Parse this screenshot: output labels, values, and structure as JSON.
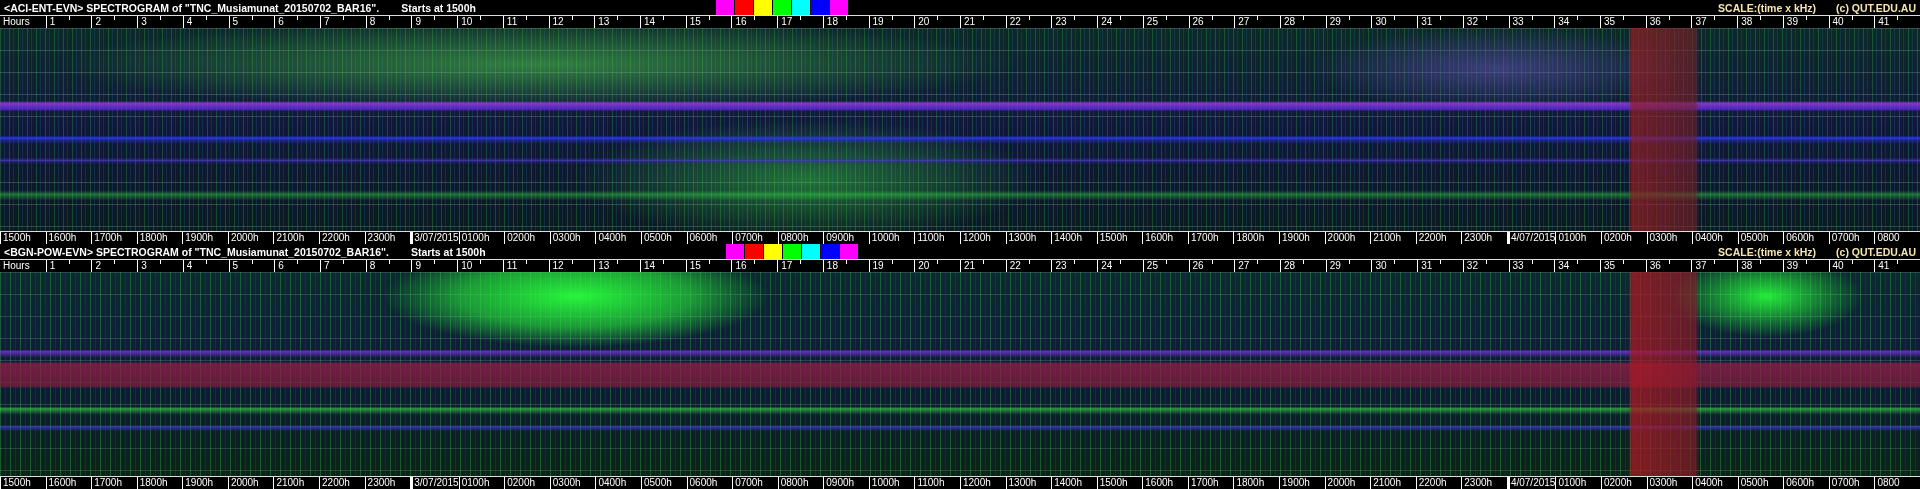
{
  "panels": [
    {
      "title": "<ACI-ENT-EVN> SPECTROGRAM  of \"TNC_Musiamunat_20150702_BAR16\".",
      "start": "Starts at 1500h",
      "swatches": [
        {
          "color": "#ff00ff"
        },
        {
          "color": "#ff0000"
        },
        {
          "color": "#ffff00"
        },
        {
          "color": "#00ff00"
        },
        {
          "color": "#00ffff"
        },
        {
          "color": "#0000ff"
        },
        {
          "color": "#ff00ff"
        }
      ],
      "scale": "SCALE:(time x kHz)",
      "credit": "(c) QUT.EDU.AU",
      "hours_label": "Hours",
      "hour_ticks": [
        "1",
        "2",
        "3",
        "4",
        "5",
        "6",
        "7",
        "8",
        "9",
        "10",
        "11",
        "12",
        "13",
        "14",
        "15",
        "16",
        "17",
        "18",
        "19",
        "20",
        "21",
        "22",
        "23",
        "24",
        "25",
        "26",
        "27",
        "28",
        "29",
        "30",
        "31",
        "32",
        "33",
        "34",
        "35",
        "36",
        "37",
        "38",
        "39",
        "40",
        "41"
      ],
      "time_labels": [
        {
          "text": "1500h",
          "kind": "hour"
        },
        {
          "text": "1600h",
          "kind": "hour"
        },
        {
          "text": "1700h",
          "kind": "hour"
        },
        {
          "text": "1800h",
          "kind": "hour"
        },
        {
          "text": "1900h",
          "kind": "hour"
        },
        {
          "text": "2000h",
          "kind": "hour"
        },
        {
          "text": "2100h",
          "kind": "hour"
        },
        {
          "text": "2200h",
          "kind": "hour"
        },
        {
          "text": "2300h",
          "kind": "hour"
        },
        {
          "text": "3/07/2015",
          "kind": "date"
        },
        {
          "text": "0100h",
          "kind": "hour"
        },
        {
          "text": "0200h",
          "kind": "hour"
        },
        {
          "text": "0300h",
          "kind": "hour"
        },
        {
          "text": "0400h",
          "kind": "hour"
        },
        {
          "text": "0500h",
          "kind": "hour"
        },
        {
          "text": "0600h",
          "kind": "hour"
        },
        {
          "text": "0700h",
          "kind": "hour"
        },
        {
          "text": "0800h",
          "kind": "hour"
        },
        {
          "text": "0900h",
          "kind": "hour"
        },
        {
          "text": "1000h",
          "kind": "hour"
        },
        {
          "text": "1100h",
          "kind": "hour"
        },
        {
          "text": "1200h",
          "kind": "hour"
        },
        {
          "text": "1300h",
          "kind": "hour"
        },
        {
          "text": "1400h",
          "kind": "hour"
        },
        {
          "text": "1500h",
          "kind": "hour"
        },
        {
          "text": "1600h",
          "kind": "hour"
        },
        {
          "text": "1700h",
          "kind": "hour"
        },
        {
          "text": "1800h",
          "kind": "hour"
        },
        {
          "text": "1900h",
          "kind": "hour"
        },
        {
          "text": "2000h",
          "kind": "hour"
        },
        {
          "text": "2100h",
          "kind": "hour"
        },
        {
          "text": "2200h",
          "kind": "hour"
        },
        {
          "text": "2300h",
          "kind": "hour"
        },
        {
          "text": "4/07/2015",
          "kind": "date"
        },
        {
          "text": "0100h",
          "kind": "hour"
        },
        {
          "text": "0200h",
          "kind": "hour"
        },
        {
          "text": "0300h",
          "kind": "hour"
        },
        {
          "text": "0400h",
          "kind": "hour"
        },
        {
          "text": "0500h",
          "kind": "hour"
        },
        {
          "text": "0600h",
          "kind": "hour"
        },
        {
          "text": "0700h",
          "kind": "hour"
        },
        {
          "text": "0800",
          "kind": "hour"
        }
      ]
    },
    {
      "title": "<BGN-POW-EVN> SPECTROGRAM  of \"TNC_Musiamunat_20150702_BAR16\".",
      "start": "Starts at 1500h",
      "swatches": [
        {
          "color": "#ff00ff"
        },
        {
          "color": "#ff0000"
        },
        {
          "color": "#ffff00"
        },
        {
          "color": "#00ff00"
        },
        {
          "color": "#00ffff"
        },
        {
          "color": "#0000ff"
        },
        {
          "color": "#ff00ff"
        }
      ],
      "scale": "SCALE:(time x kHz)",
      "credit": "(c) QUT.EDU.AU",
      "hours_label": "Hours",
      "hour_ticks": [
        "1",
        "2",
        "3",
        "4",
        "5",
        "6",
        "7",
        "8",
        "9",
        "10",
        "11",
        "12",
        "13",
        "14",
        "15",
        "16",
        "17",
        "18",
        "19",
        "20",
        "21",
        "22",
        "23",
        "24",
        "25",
        "26",
        "27",
        "28",
        "29",
        "30",
        "31",
        "32",
        "33",
        "34",
        "35",
        "36",
        "37",
        "38",
        "39",
        "40",
        "41"
      ],
      "time_labels": [
        {
          "text": "1500h",
          "kind": "hour"
        },
        {
          "text": "1600h",
          "kind": "hour"
        },
        {
          "text": "1700h",
          "kind": "hour"
        },
        {
          "text": "1800h",
          "kind": "hour"
        },
        {
          "text": "1900h",
          "kind": "hour"
        },
        {
          "text": "2000h",
          "kind": "hour"
        },
        {
          "text": "2100h",
          "kind": "hour"
        },
        {
          "text": "2200h",
          "kind": "hour"
        },
        {
          "text": "2300h",
          "kind": "hour"
        },
        {
          "text": "3/07/2015",
          "kind": "date"
        },
        {
          "text": "0100h",
          "kind": "hour"
        },
        {
          "text": "0200h",
          "kind": "hour"
        },
        {
          "text": "0300h",
          "kind": "hour"
        },
        {
          "text": "0400h",
          "kind": "hour"
        },
        {
          "text": "0500h",
          "kind": "hour"
        },
        {
          "text": "0600h",
          "kind": "hour"
        },
        {
          "text": "0700h",
          "kind": "hour"
        },
        {
          "text": "0800h",
          "kind": "hour"
        },
        {
          "text": "0900h",
          "kind": "hour"
        },
        {
          "text": "1000h",
          "kind": "hour"
        },
        {
          "text": "1100h",
          "kind": "hour"
        },
        {
          "text": "1200h",
          "kind": "hour"
        },
        {
          "text": "1300h",
          "kind": "hour"
        },
        {
          "text": "1400h",
          "kind": "hour"
        },
        {
          "text": "1500h",
          "kind": "hour"
        },
        {
          "text": "1600h",
          "kind": "hour"
        },
        {
          "text": "1700h",
          "kind": "hour"
        },
        {
          "text": "1800h",
          "kind": "hour"
        },
        {
          "text": "1900h",
          "kind": "hour"
        },
        {
          "text": "2000h",
          "kind": "hour"
        },
        {
          "text": "2100h",
          "kind": "hour"
        },
        {
          "text": "2200h",
          "kind": "hour"
        },
        {
          "text": "2300h",
          "kind": "hour"
        },
        {
          "text": "4/07/2015",
          "kind": "date"
        },
        {
          "text": "0100h",
          "kind": "hour"
        },
        {
          "text": "0200h",
          "kind": "hour"
        },
        {
          "text": "0300h",
          "kind": "hour"
        },
        {
          "text": "0400h",
          "kind": "hour"
        },
        {
          "text": "0500h",
          "kind": "hour"
        },
        {
          "text": "0600h",
          "kind": "hour"
        },
        {
          "text": "0700h",
          "kind": "hour"
        },
        {
          "text": "0800",
          "kind": "hour"
        }
      ]
    }
  ]
}
